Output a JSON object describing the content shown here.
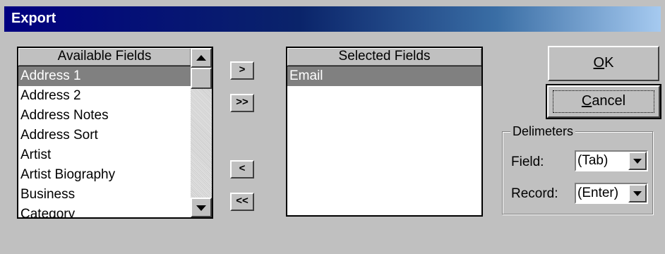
{
  "window": {
    "title": "Export"
  },
  "available": {
    "header": "Available Fields",
    "items": [
      "Address 1",
      "Address 2",
      "Address Notes",
      "Address Sort",
      "Artist",
      "Artist Biography",
      "Business",
      "Category"
    ],
    "selected_index": 0
  },
  "selected": {
    "header": "Selected Fields",
    "items": [
      "Email"
    ]
  },
  "move_buttons": {
    "add": ">",
    "add_all": ">>",
    "remove": "<",
    "remove_all": "<<"
  },
  "actions": {
    "ok_mnemonic": "O",
    "ok_rest": "K",
    "cancel_mnemonic": "C",
    "cancel_rest": "ancel"
  },
  "delimiters": {
    "label": "Delimeters",
    "field_label": "Field:",
    "field_value": "(Tab)",
    "record_label": "Record:",
    "record_value": "(Enter)"
  },
  "icons": {
    "scroll_up": "triangle-up",
    "scroll_down": "triangle-down",
    "dropdown": "triangle-down"
  }
}
